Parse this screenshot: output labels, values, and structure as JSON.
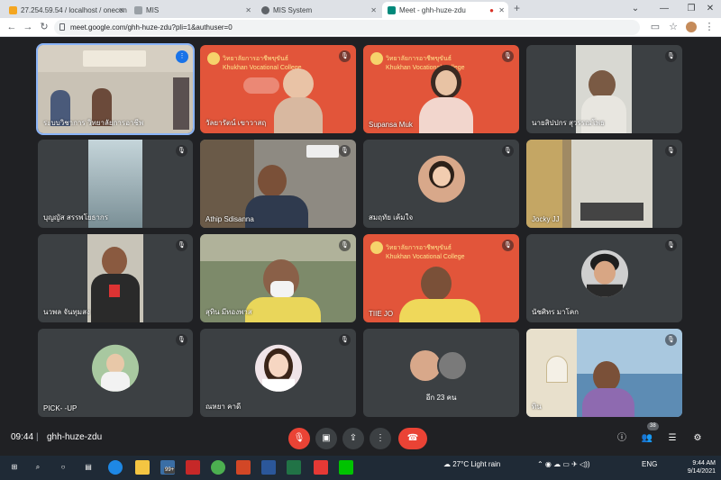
{
  "browser": {
    "tabs": [
      {
        "title": "27.254.59.54 / localhost / onecon",
        "color": "#5f6368"
      },
      {
        "title": "MIS",
        "color": "#9aa0a6"
      },
      {
        "title": "MIS System",
        "color": "#5f6368"
      },
      {
        "title": "Meet - ghh-huze-zdu",
        "color": "#00897b"
      }
    ],
    "new_tab": "+",
    "url": "meet.google.com/ghh-huze-zdu?pli=1&authuser=0"
  },
  "participants": [
    {
      "name": "ระบบวิชาการ วิทยาลัยการอาชีพ",
      "muted": false,
      "speaking": true,
      "bg": "#c9c2b5",
      "kind": "video"
    },
    {
      "name": "วัลยารัตน์ เขาวาสฤ",
      "muted": true,
      "bg": "#e2553a",
      "kind": "banner"
    },
    {
      "name": "Supansa Muk",
      "muted": true,
      "bg": "#e2553a",
      "kind": "banner"
    },
    {
      "name": "นายสิปปกร สุวรรณโพธ",
      "muted": true,
      "bg": "#3c4043",
      "kind": "photo"
    },
    {
      "name": "บุญญัส สรรพโยธากร",
      "muted": true,
      "bg": "#3c4043",
      "kind": "photo"
    },
    {
      "name": "Athip Sdisanna",
      "muted": true,
      "bg": "#8e8a82",
      "kind": "video"
    },
    {
      "name": "สมฤทัย เค้มใจ",
      "muted": true,
      "bg": "#3c4043",
      "kind": "avatar"
    },
    {
      "name": "Jocky JJ",
      "muted": true,
      "bg": "#3c4043",
      "kind": "photo"
    },
    {
      "name": "นวพล จันทุมสง",
      "muted": true,
      "bg": "#3c4043",
      "kind": "photo"
    },
    {
      "name": "สุทิน มีทองพาส",
      "muted": true,
      "bg": "#7d8a6a",
      "kind": "video"
    },
    {
      "name": "TIIE JO",
      "muted": true,
      "bg": "#e2553a",
      "kind": "banner"
    },
    {
      "name": "นัชศิทร มาโคก",
      "muted": true,
      "bg": "#3c4043",
      "kind": "avatar"
    },
    {
      "name": "PICK- -UP",
      "muted": true,
      "bg": "#3c4043",
      "kind": "avatar"
    },
    {
      "name": "ณหยา คาดี",
      "muted": true,
      "bg": "#3c4043",
      "kind": "avatar"
    },
    {
      "name": "อีก 23 คน",
      "muted": false,
      "bg": "#3c4043",
      "kind": "more"
    },
    {
      "name": "ทิน",
      "muted": true,
      "bg": "#a9c8df",
      "kind": "video"
    }
  ],
  "banner_text": {
    "line1": "วิทยาลัยการอาชีพขุขันธ์",
    "line2": "Khukhan Vocational College"
  },
  "meeting": {
    "time": "09:44",
    "separator": "|",
    "code": "ghh-huze-zdu",
    "participant_count": "38"
  },
  "taskbar": {
    "weather": "27°C Light rain",
    "lang": "ENG",
    "time": "9:44 AM",
    "date": "9/14/2021",
    "badge": "99+"
  },
  "colors": {
    "bg": "#202124",
    "tile": "#3c4043",
    "hangup": "#ea4335",
    "accent": "#1a73e8"
  }
}
